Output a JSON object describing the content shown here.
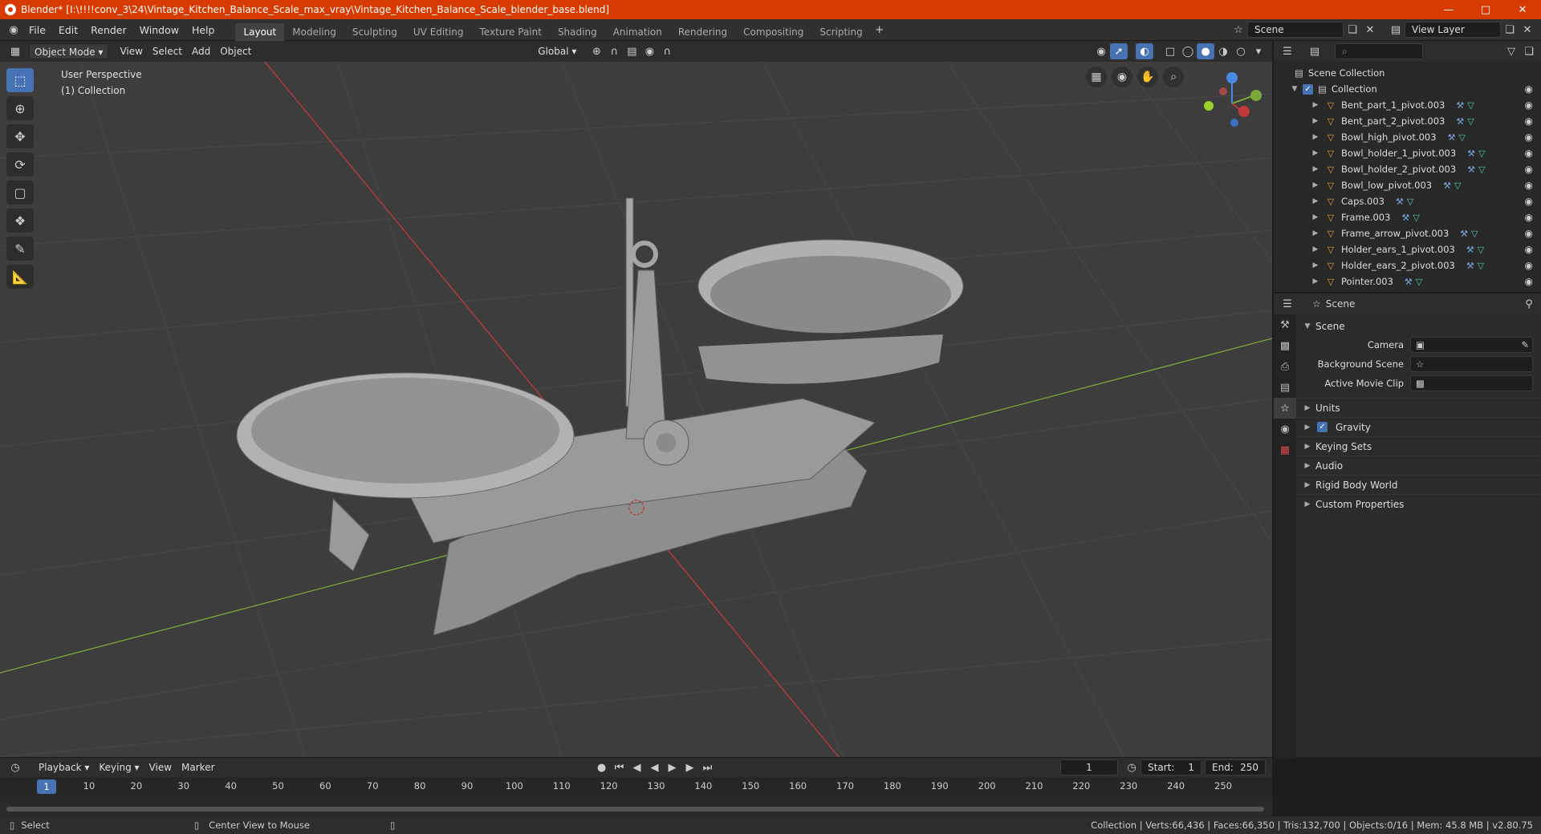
{
  "window": {
    "title": "Blender* [I:\\!!!!conv_3\\24\\Vintage_Kitchen_Balance_Scale_max_vray\\Vintage_Kitchen_Balance_Scale_blender_base.blend]"
  },
  "menu": [
    "File",
    "Edit",
    "Render",
    "Window",
    "Help"
  ],
  "workspaces": [
    "Layout",
    "Modeling",
    "Sculpting",
    "UV Editing",
    "Texture Paint",
    "Shading",
    "Animation",
    "Rendering",
    "Compositing",
    "Scripting"
  ],
  "scene_field": "Scene",
  "view_layer_field": "View Layer",
  "viewport_header": {
    "mode": "Object Mode",
    "menus": [
      "View",
      "Select",
      "Add",
      "Object"
    ],
    "orientation": "Global"
  },
  "viewport": {
    "perspective": "User Perspective",
    "collection": "(1) Collection"
  },
  "outliner": {
    "root": "Scene Collection",
    "collection": "Collection",
    "items": [
      "Bent_part_1_pivot.003",
      "Bent_part_2_pivot.003",
      "Bowl_high_pivot.003",
      "Bowl_holder_1_pivot.003",
      "Bowl_holder_2_pivot.003",
      "Bowl_low_pivot.003",
      "Caps.003",
      "Frame.003",
      "Frame_arrow_pivot.003",
      "Holder_ears_1_pivot.003",
      "Holder_ears_2_pivot.003",
      "Pointer.003"
    ]
  },
  "properties": {
    "header": "Scene",
    "panel": "Scene",
    "camera_label": "Camera",
    "bg_scene_label": "Background Scene",
    "movie_clip_label": "Active Movie Clip",
    "subpanels": [
      "Units",
      "Gravity",
      "Keying Sets",
      "Audio",
      "Rigid Body World",
      "Custom Properties"
    ]
  },
  "timeline": {
    "menus": [
      "Playback",
      "Keying",
      "View",
      "Marker"
    ],
    "current_frame": "1",
    "start_label": "Start:",
    "start": "1",
    "end_label": "End:",
    "end": "250",
    "ticks": [
      "10",
      "20",
      "30",
      "40",
      "50",
      "60",
      "70",
      "80",
      "90",
      "100",
      "110",
      "120",
      "130",
      "140",
      "150",
      "160",
      "170",
      "180",
      "190",
      "200",
      "210",
      "220",
      "230",
      "240",
      "250"
    ],
    "indicator": "1"
  },
  "status": {
    "left": "Select",
    "middle": "Center View to Mouse",
    "right": "Collection | Verts:66,436 | Faces:66,350 | Tris:132,700 | Objects:0/16 | Mem: 45.8 MB | v2.80.75"
  },
  "colors": {
    "titlebar": "#d83b01",
    "accent": "#4772b3",
    "x_axis": "#c0393b",
    "y_axis": "#7ba83a"
  }
}
